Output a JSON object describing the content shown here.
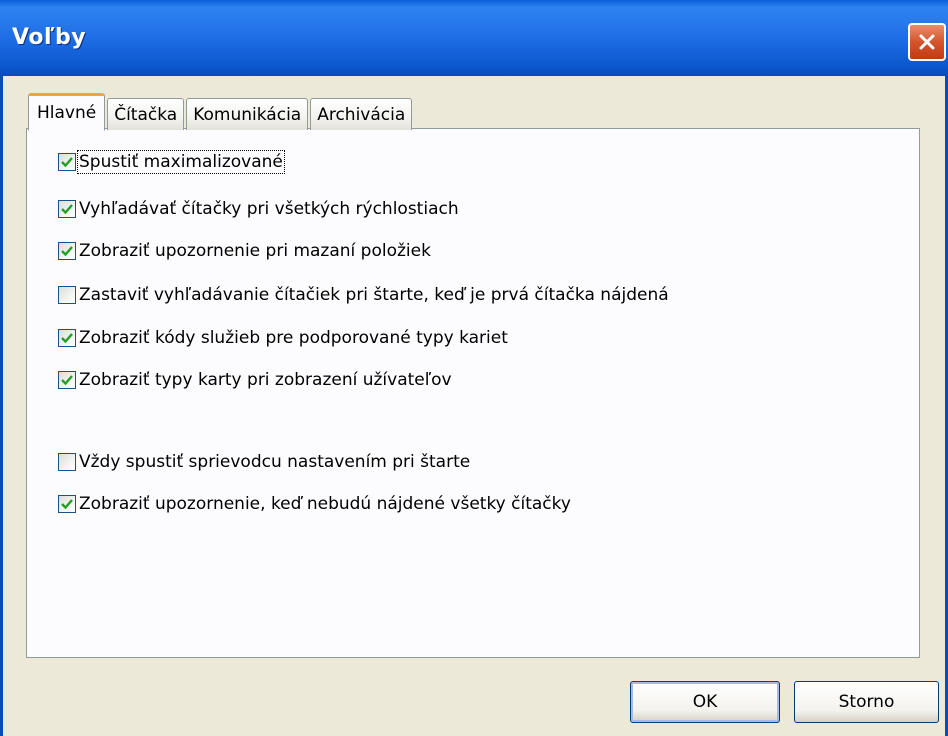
{
  "window": {
    "title": "Voľby"
  },
  "tabs": [
    {
      "label": "Hlavné",
      "active": true
    },
    {
      "label": "Čítačka",
      "active": false
    },
    {
      "label": "Komunikácia",
      "active": false
    },
    {
      "label": "Archivácia",
      "active": false
    }
  ],
  "options": [
    {
      "label": "Spustiť maximalizované",
      "checked": true
    },
    {
      "label": "Vyhľadávať čítačky pri všetkých rýchlostiach",
      "checked": true
    },
    {
      "label": "Zobraziť upozornenie pri mazaní položiek",
      "checked": true
    },
    {
      "label": "Zastaviť vyhľadávanie čítačiek pri štarte, keď je prvá čítačka nájdená",
      "checked": false
    },
    {
      "label": "Zobraziť kódy služieb pre podporované typy kariet",
      "checked": true
    },
    {
      "label": "Zobraziť typy karty pri zobrazení užívateľov",
      "checked": true
    },
    {
      "label": "Vždy spustiť sprievodcu nastavením pri štarte",
      "checked": false
    },
    {
      "label": "Zobraziť upozornenie, keď nebudú nájdené všetky čítačky",
      "checked": true
    }
  ],
  "buttons": {
    "ok_label": "OK",
    "cancel_label": "Storno"
  },
  "colors": {
    "titlebar": "#0a5fd8",
    "active_tab_accent": "#f0a72a",
    "checkmark": "#21a121",
    "close_button": "#d4552b"
  },
  "icons": {
    "close": "close-icon",
    "checkmark": "checkmark-icon"
  }
}
